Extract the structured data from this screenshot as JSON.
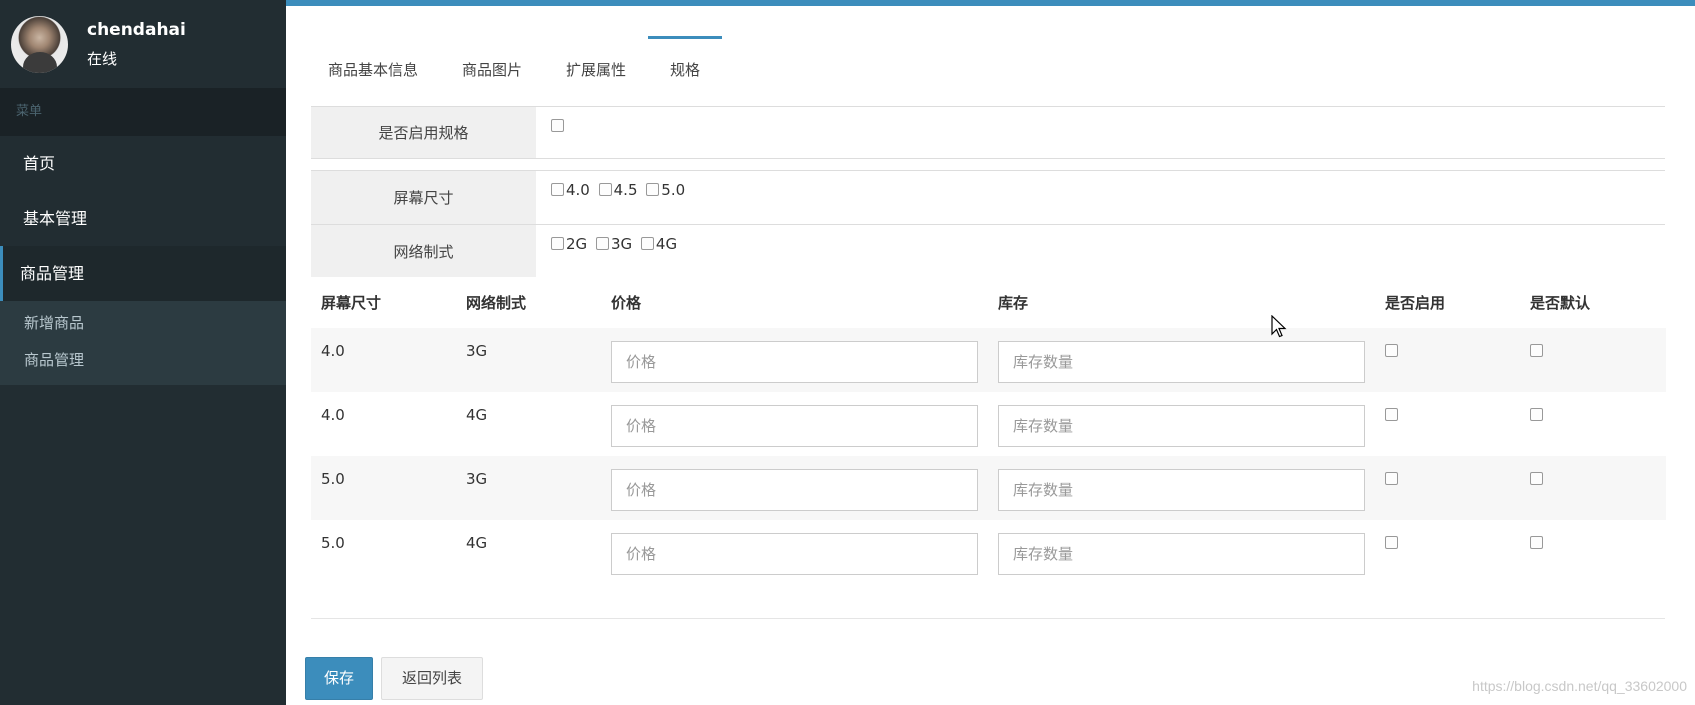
{
  "user": {
    "name": "chendahai",
    "status": "在线"
  },
  "menu": {
    "header": "菜单",
    "items": [
      {
        "label": "首页"
      },
      {
        "label": "基本管理"
      },
      {
        "label": "商品管理"
      }
    ],
    "submenu": [
      {
        "label": "新增商品"
      },
      {
        "label": "商品管理"
      }
    ]
  },
  "tabs": [
    "商品基本信息",
    "商品图片",
    "扩展属性",
    "规格"
  ],
  "spec": {
    "enable_label": "是否启用规格",
    "screen_label": "屏幕尺寸",
    "screen_options": [
      "4.0",
      "4.5",
      "5.0"
    ],
    "network_label": "网络制式",
    "network_options": [
      "2G",
      "3G",
      "4G"
    ]
  },
  "table": {
    "headers": [
      "屏幕尺寸",
      "网络制式",
      "价格",
      "库存",
      "是否启用",
      "是否默认"
    ],
    "rows": [
      {
        "screen": "4.0",
        "network": "3G"
      },
      {
        "screen": "4.0",
        "network": "4G"
      },
      {
        "screen": "5.0",
        "network": "3G"
      },
      {
        "screen": "5.0",
        "network": "4G"
      }
    ],
    "price_placeholder": "价格",
    "stock_placeholder": "库存数量"
  },
  "buttons": {
    "save": "保存",
    "back": "返回列表"
  },
  "watermark": "https://blog.csdn.net/qq_33602000",
  "colors": {
    "accent": "#3c8dbc",
    "sidebar": "#222d32"
  }
}
